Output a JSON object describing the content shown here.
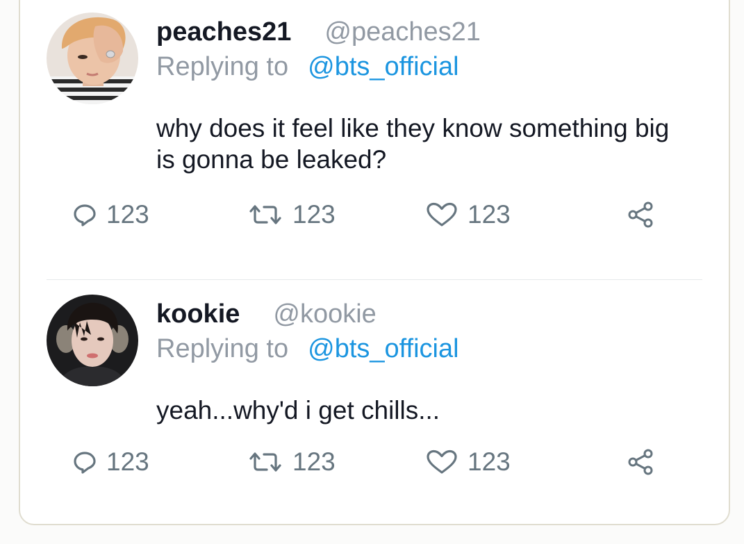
{
  "colors": {
    "name": "#141823",
    "muted": "#9199a3",
    "link": "#1b95e0",
    "action": "#66757f"
  },
  "tweets": [
    {
      "display_name": "peaches21",
      "handle": "@peaches21",
      "replying_label": "Replying to",
      "replying_to": "@bts_official",
      "text_lines": [
        "why does it feel like they know something big",
        "is gonna be leaked?"
      ],
      "actions": {
        "reply_count": "123",
        "retweet_count": "123",
        "like_count": "123"
      },
      "icons": [
        "reply-icon",
        "retweet-icon",
        "heart-icon",
        "share-icon"
      ]
    },
    {
      "display_name": "kookie",
      "handle": "@kookie",
      "replying_label": "Replying to",
      "replying_to": "@bts_official",
      "text_lines": [
        "yeah...why'd i get chills..."
      ],
      "actions": {
        "reply_count": "123",
        "retweet_count": "123",
        "like_count": "123"
      },
      "icons": [
        "reply-icon",
        "retweet-icon",
        "heart-icon",
        "share-icon"
      ]
    }
  ]
}
